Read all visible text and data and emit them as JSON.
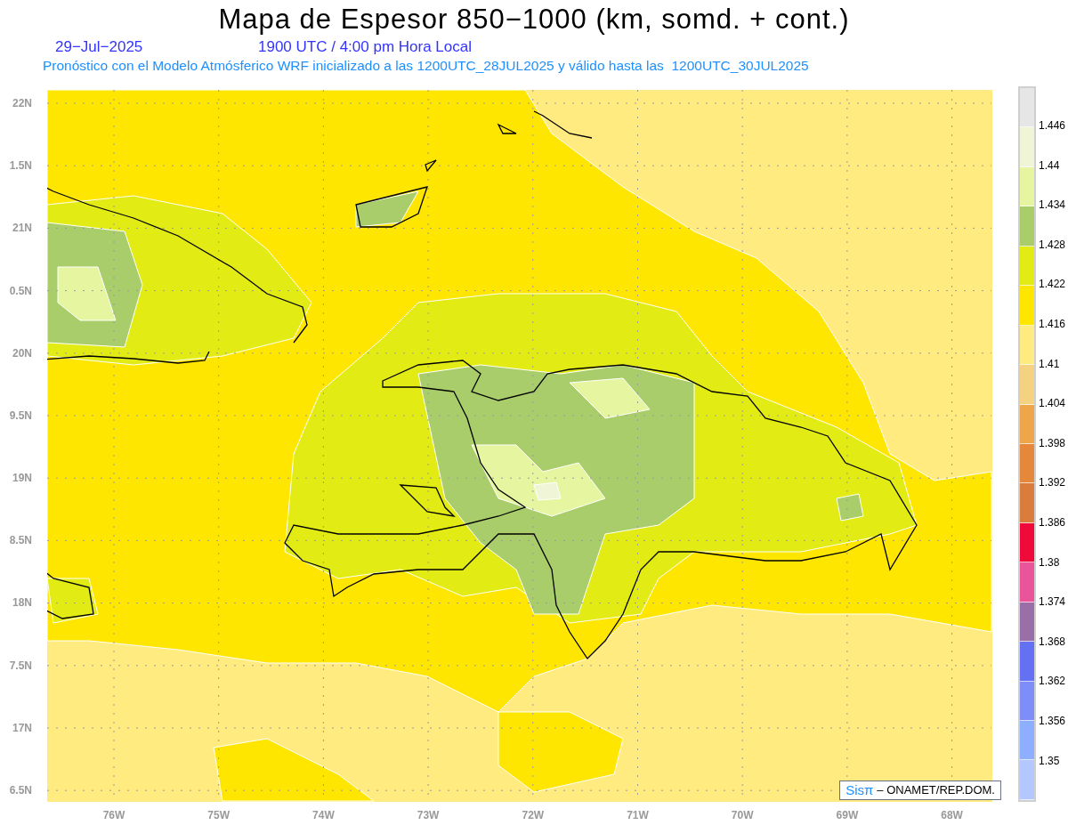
{
  "title": "Mapa de Espesor 850−1000 (km, somd. + cont.)",
  "date": "29−Jul−2025",
  "time": "1900 UTC / 4:00 pm Hora Local",
  "subtitle": "Pronóstico con el Modelo Atmósferico WRF inicializado a las 1200UTC_28JUL2025 y válido hasta las  1200UTC_30JUL2025",
  "y_axis_labels": [
    "22N",
    "1.5N",
    "21N",
    "0.5N",
    "20N",
    "9.5N",
    "19N",
    "8.5N",
    "18N",
    "7.5N",
    "17N",
    "6.5N"
  ],
  "x_axis_labels": [
    "76W",
    "75W",
    "74W",
    "73W",
    "72W",
    "71W",
    "70W",
    "69W",
    "68W"
  ],
  "colorbar": {
    "segments": [
      {
        "color": "#e6e6e6"
      },
      {
        "color": "#eff5d6"
      },
      {
        "color": "#e6f5a0"
      },
      {
        "color": "#a8cd6a"
      },
      {
        "color": "#e2ec14"
      },
      {
        "color": "#ffe600"
      },
      {
        "color": "#ffeb80"
      },
      {
        "color": "#f5d282"
      },
      {
        "color": "#efa64a"
      },
      {
        "color": "#e6883c"
      },
      {
        "color": "#d97c3c"
      },
      {
        "color": "#ef0a3c"
      },
      {
        "color": "#e8559b"
      },
      {
        "color": "#9a6fa8"
      },
      {
        "color": "#6471f2"
      },
      {
        "color": "#7d8ef8"
      },
      {
        "color": "#8eafff"
      },
      {
        "color": "#b4c8ff"
      }
    ],
    "labels": [
      "1.446",
      "1.44",
      "1.434",
      "1.428",
      "1.422",
      "1.416",
      "1.41",
      "1.404",
      "1.398",
      "1.392",
      "1.386",
      "1.38",
      "1.374",
      "1.368",
      "1.362",
      "1.356",
      "1.35"
    ]
  },
  "credit": {
    "logo": "Sisπ",
    "text": "– ONAMET/REP.DOM."
  }
}
